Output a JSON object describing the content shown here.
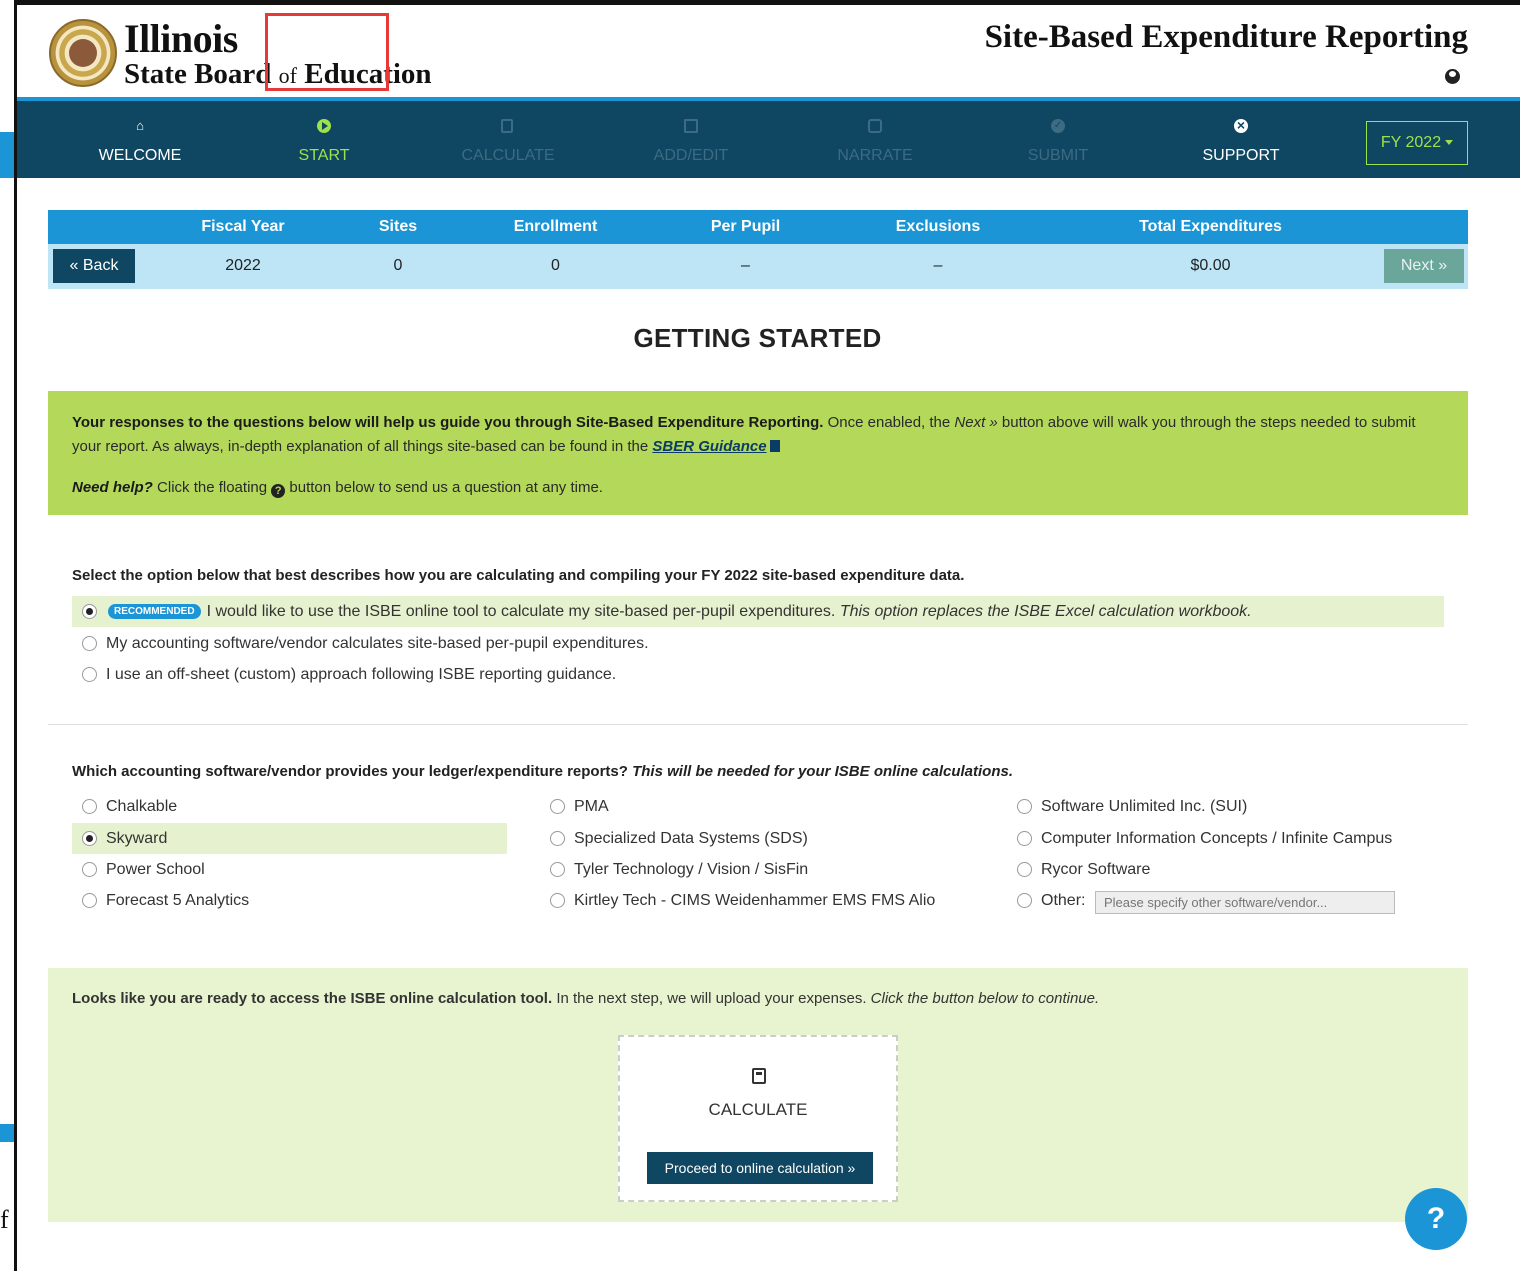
{
  "header": {
    "logo_line1": "Illinois",
    "logo_line2_a": "State Board ",
    "logo_line2_of": "of",
    "logo_line2_b": " Education",
    "app_title": "Site-Based Expenditure Reporting"
  },
  "nav": {
    "items": [
      {
        "label": "WELCOME",
        "icon": "welcome-icon",
        "state": "enabled"
      },
      {
        "label": "START",
        "icon": "play-circle-icon",
        "state": "active"
      },
      {
        "label": "CALCULATE",
        "icon": "calculator-icon",
        "state": "disabled"
      },
      {
        "label": "ADD/EDIT",
        "icon": "edit-icon",
        "state": "disabled"
      },
      {
        "label": "NARRATE",
        "icon": "chat-icon",
        "state": "disabled"
      },
      {
        "label": "SUBMIT",
        "icon": "check-circle-icon",
        "state": "disabled"
      },
      {
        "label": "SUPPORT",
        "icon": "support-icon",
        "state": "enabled"
      }
    ],
    "fy_selected": "FY 2022"
  },
  "summary": {
    "headers": [
      "Fiscal Year",
      "Sites",
      "Enrollment",
      "Per Pupil",
      "Exclusions",
      "Total Expenditures"
    ],
    "values": [
      "2022",
      "0",
      "0",
      "–",
      "–",
      "$0.00"
    ],
    "back_label": "« Back",
    "next_label": "Next »"
  },
  "main": {
    "heading": "GETTING STARTED",
    "intro_bold": "Your responses to the questions below will help us guide you through Site-Based Expenditure Reporting.",
    "intro_rest1": " Once enabled, the ",
    "intro_next_word": "Next »",
    "intro_rest2": " button above will walk you through the steps needed to submit your report. As always, in-depth explanation of all things site-based can be found in the ",
    "intro_link": "SBER Guidance",
    "help_bold": "Need help?",
    "help_a": " Click the floating ",
    "help_b": " button below to send us a question at any time."
  },
  "question1": {
    "prompt": "Select the option below that best describes how you are calculating and compiling your FY 2022 site-based expenditure data.",
    "badge": "RECOMMENDED",
    "options": [
      {
        "text": "I would like to use the ISBE online tool to calculate my site-based per-pupil expenditures.",
        "italic": "This option replaces the ISBE Excel calculation workbook.",
        "selected": true
      },
      {
        "text": "My accounting software/vendor calculates site-based per-pupil expenditures.",
        "selected": false
      },
      {
        "text": "I use an off-sheet (custom) approach following ISBE reporting guidance.",
        "selected": false
      }
    ]
  },
  "question2": {
    "prompt": "Which accounting software/vendor provides your ledger/expenditure reports?",
    "prompt_italic": "This will be needed for your ISBE online calculations.",
    "options": [
      "Chalkable",
      "Skyward",
      "Power School",
      "Forecast 5 Analytics",
      "PMA",
      "Specialized Data Systems (SDS)",
      "Tyler Technology / Vision / SisFin",
      "Kirtley Tech - CIMS Weidenhammer EMS FMS Alio",
      "Software Unlimited Inc. (SUI)",
      "Computer Information Concepts / Infinite Campus",
      "Rycor Software",
      "Other:"
    ],
    "selected": "Skyward",
    "other_placeholder": "Please specify other software/vendor..."
  },
  "ready": {
    "bold": "Looks like you are ready to access the ISBE online calculation tool.",
    "text": " In the next step, we will upload your expenses. ",
    "italic": "Click the button below to continue.",
    "card_label": "CALCULATE",
    "button": "Proceed to online calculation »"
  },
  "float_help": "?",
  "colors": {
    "nav_bg": "#0f4661",
    "accent_blue": "#1b95d6",
    "active_green": "#9ee24b",
    "intro_green": "#b4d95a",
    "highlight_red": "#e63a3a"
  }
}
